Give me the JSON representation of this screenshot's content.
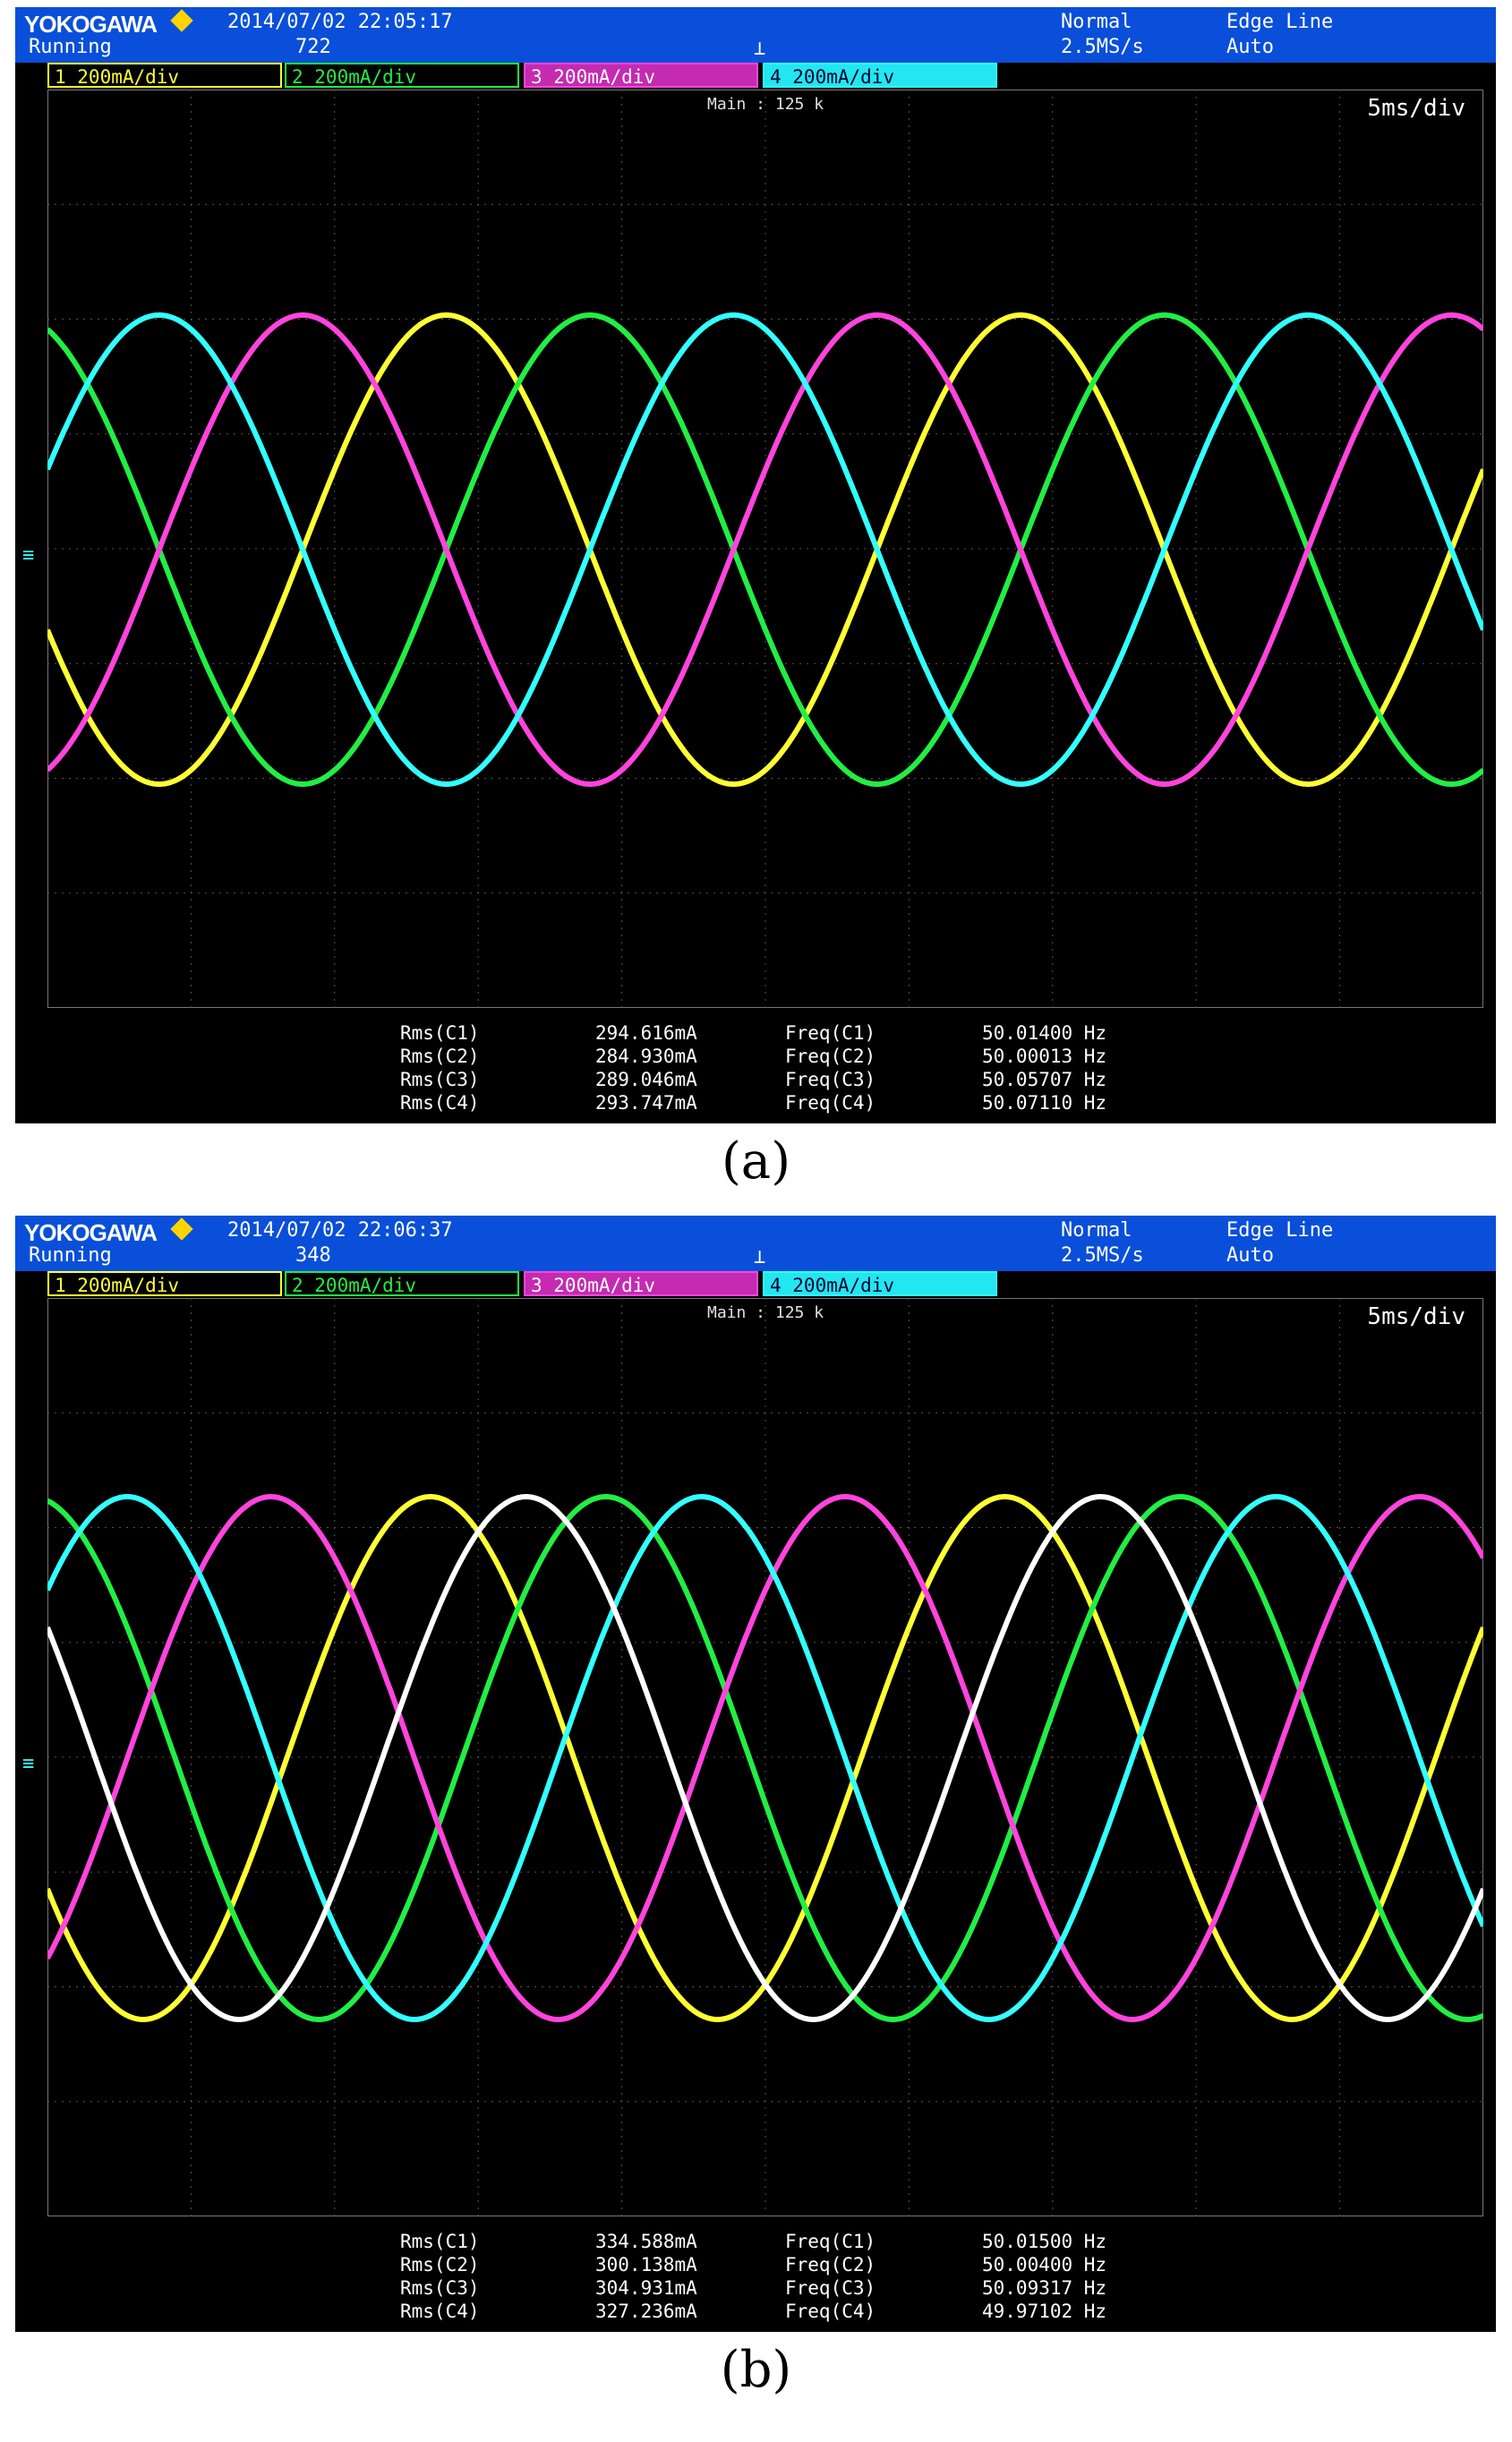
{
  "panels": [
    {
      "id": "a",
      "caption": "(a)",
      "brand": "YOKOGAWA",
      "datetime": "2014/07/02 22:05:17",
      "status": "Running",
      "acq_count": "722",
      "mode": "Normal",
      "sample_rate": "2.5MS/s",
      "trigger_type": "Edge Line",
      "trigger_mode": "Auto",
      "main_label": "Main : 125 k",
      "time_div": "5ms/div",
      "channels": [
        {
          "label": "1  200mA/div",
          "color": "#ffff33"
        },
        {
          "label": "2  200mA/div",
          "color": "#22ee44"
        },
        {
          "label": "3  200mA/div",
          "color": "#ff44dd"
        },
        {
          "label": "4  200mA/div",
          "color": "#33ffff"
        }
      ],
      "measurements": [
        {
          "rms_label": "Rms(C1)",
          "rms_value": "294.616mA",
          "freq_label": "Freq(C1)",
          "freq_value": "50.01400 Hz"
        },
        {
          "rms_label": "Rms(C2)",
          "rms_value": "284.930mA",
          "freq_label": "Freq(C2)",
          "freq_value": "50.00013 Hz"
        },
        {
          "rms_label": "Rms(C3)",
          "rms_value": "289.046mA",
          "freq_label": "Freq(C3)",
          "freq_value": "50.05707 Hz"
        },
        {
          "rms_label": "Rms(C4)",
          "rms_value": "293.747mA",
          "freq_label": "Freq(C4)",
          "freq_value": "50.07110 Hz"
        }
      ],
      "waveforms": [
        {
          "color": "#ffff33",
          "phase_deg": 200
        },
        {
          "color": "#22ee44",
          "phase_deg": 110
        },
        {
          "color": "#ff44dd",
          "phase_deg": 290
        },
        {
          "color": "#33ffff",
          "phase_deg": 20
        }
      ]
    },
    {
      "id": "b",
      "caption": "(b)",
      "brand": "YOKOGAWA",
      "datetime": "2014/07/02 22:06:37",
      "status": "Running",
      "acq_count": "348",
      "mode": "Normal",
      "sample_rate": "2.5MS/s",
      "trigger_type": "Edge Line",
      "trigger_mode": "Auto",
      "main_label": "Main : 125 k",
      "time_div": "5ms/div",
      "channels": [
        {
          "label": "1  200mA/div",
          "color": "#ffff33"
        },
        {
          "label": "2  200mA/div",
          "color": "#22ee44"
        },
        {
          "label": "3  200mA/div",
          "color": "#ff44dd"
        },
        {
          "label": "4  200mA/div",
          "color": "#33ffff"
        }
      ],
      "measurements": [
        {
          "rms_label": "Rms(C1)",
          "rms_value": "334.588mA",
          "freq_label": "Freq(C1)",
          "freq_value": "50.01500 Hz"
        },
        {
          "rms_label": "Rms(C2)",
          "rms_value": "300.138mA",
          "freq_label": "Freq(C2)",
          "freq_value": "50.00400 Hz"
        },
        {
          "rms_label": "Rms(C3)",
          "rms_value": "304.931mA",
          "freq_label": "Freq(C3)",
          "freq_value": "50.09317 Hz"
        },
        {
          "rms_label": "Rms(C4)",
          "rms_value": "327.236mA",
          "freq_label": "Freq(C4)",
          "freq_value": "49.97102 Hz"
        }
      ],
      "waveforms": [
        {
          "color": "#ffff33",
          "phase_deg": 210
        },
        {
          "color": "#22ee44",
          "phase_deg": 100
        },
        {
          "color": "#ff44dd",
          "phase_deg": 310
        },
        {
          "color": "#33ffff",
          "phase_deg": 40
        },
        {
          "color": "#ffffff",
          "phase_deg": 150
        }
      ]
    }
  ]
}
